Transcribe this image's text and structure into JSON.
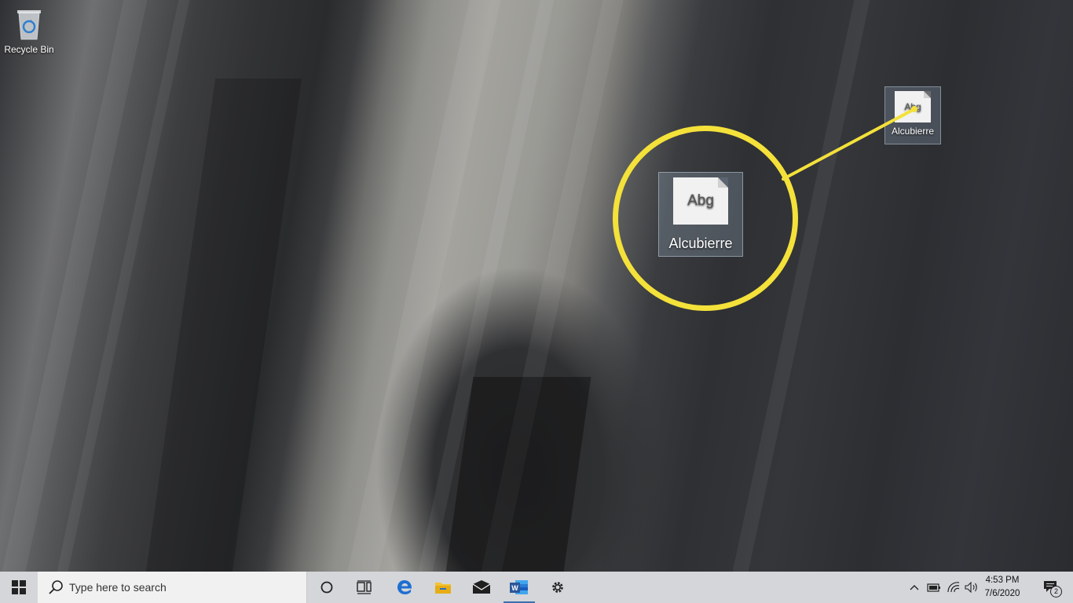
{
  "desktop": {
    "recycle_bin_label": "Recycle Bin",
    "file_small": {
      "label": "Alcubierre",
      "preview_text": "Abg"
    },
    "file_large": {
      "label": "Alcubierre",
      "preview_text": "Abg"
    },
    "highlight_color": "#f4e13a"
  },
  "taskbar": {
    "search_placeholder": "Type here to search",
    "icons": [
      "windows-start-icon",
      "search-icon",
      "cortana-icon",
      "task-view-icon",
      "edge-icon",
      "file-explorer-icon",
      "mail-icon",
      "word-icon",
      "settings-icon"
    ],
    "tray": {
      "notification_count": "2",
      "time": "4:53 PM",
      "date": "7/6/2020"
    },
    "colors": {
      "taskbar_bg": "#d4d6da",
      "search_bg": "#f1f1f1",
      "edge_blue": "#1e6fd1",
      "word_blue": "#2b579a",
      "explorer_yellow": "#f2c233"
    }
  }
}
